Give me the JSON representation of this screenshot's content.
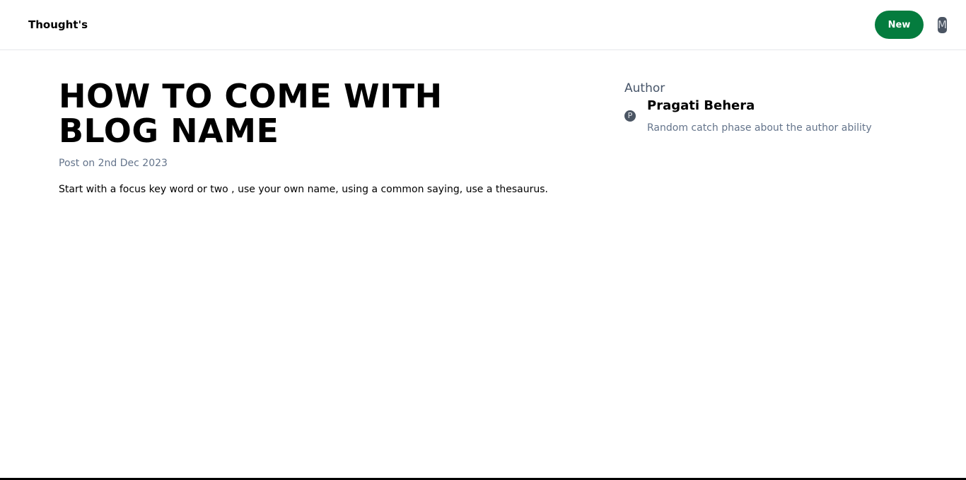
{
  "header": {
    "brand": "Thought's",
    "new_button_label": "New",
    "user_avatar_initial": "M"
  },
  "post": {
    "title": "HOW TO COME WITH BLOG NAME",
    "date": "Post on 2nd Dec 2023",
    "body": "Start with a focus key word or two , use your own name, using a common saying, use a thesaurus."
  },
  "author": {
    "heading": "Author",
    "avatar_initial": "P",
    "name": "Pragati Behera",
    "tagline": "Random catch phase about the author ability"
  },
  "colors": {
    "accent": "#047c3e",
    "muted_text": "#64748b",
    "avatar_bg": "#4b5563"
  }
}
